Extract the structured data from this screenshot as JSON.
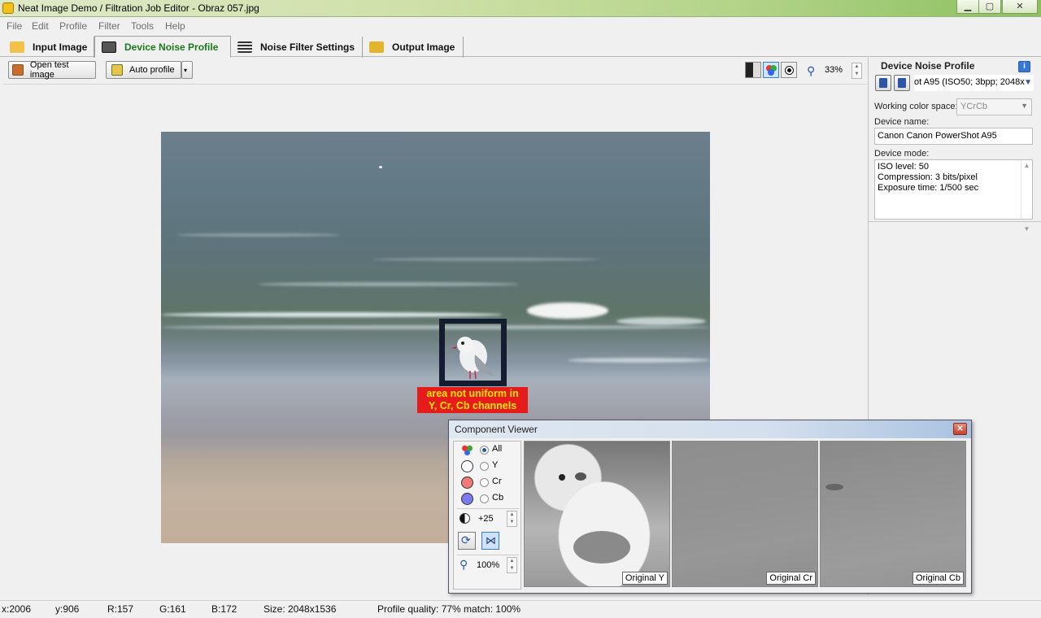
{
  "window": {
    "title": "Neat Image Demo / Filtration Job Editor - Obraz 057.jpg",
    "minimize": "▁",
    "maximize": "▢",
    "close": "✕"
  },
  "menu": {
    "items": [
      "File",
      "Edit",
      "Profile",
      "Filter",
      "Tools",
      "Help"
    ]
  },
  "tabs": [
    {
      "label": "Input Image",
      "icon": "input-image-icon"
    },
    {
      "label": "Device Noise Profile",
      "icon": "camera-icon",
      "active": true
    },
    {
      "label": "Noise Filter Settings",
      "icon": "filter-settings-icon"
    },
    {
      "label": "Output Image",
      "icon": "output-image-icon"
    }
  ],
  "toolbar": {
    "open_test_image": "Open test image",
    "auto_profile": "Auto profile",
    "zoom": "33%"
  },
  "canvas": {
    "warning_line1": "area not uniform in",
    "warning_line2": "Y, Cr, Cb channels"
  },
  "right_panel": {
    "title": "Device Noise Profile",
    "profile_combo": "ot A95 (ISO50; 3bpp; 2048x",
    "working_color_space_label": "Working color space:",
    "working_color_space_value": "YCrCb",
    "device_name_label": "Device name:",
    "device_name_value": "Canon Canon PowerShot A95",
    "device_mode_label": "Device mode:",
    "device_mode_lines": [
      "ISO level: 50",
      "Compression: 3 bits/pixel",
      "Exposure time: 1/500 sec"
    ]
  },
  "component_viewer": {
    "title": "Component Viewer",
    "channels": [
      "All",
      "Y",
      "Cr",
      "Cb"
    ],
    "selected_channel": "All",
    "contrast": "+25",
    "zoom": "100%",
    "panels": [
      "Original Y",
      "Original Cr",
      "Original Cb"
    ]
  },
  "status": {
    "x": "x:2006",
    "y": "y:906",
    "r": "R:157",
    "g": "G:161",
    "b": "B:172",
    "size": "Size: 2048x1536",
    "quality": "Profile quality: 77%  match: 100%"
  },
  "colors": {
    "active_tab_text": "#1a7a1a",
    "warning_bg": "#e61b1b",
    "warning_text": "#ffe600",
    "accent": "#2b56a8"
  }
}
